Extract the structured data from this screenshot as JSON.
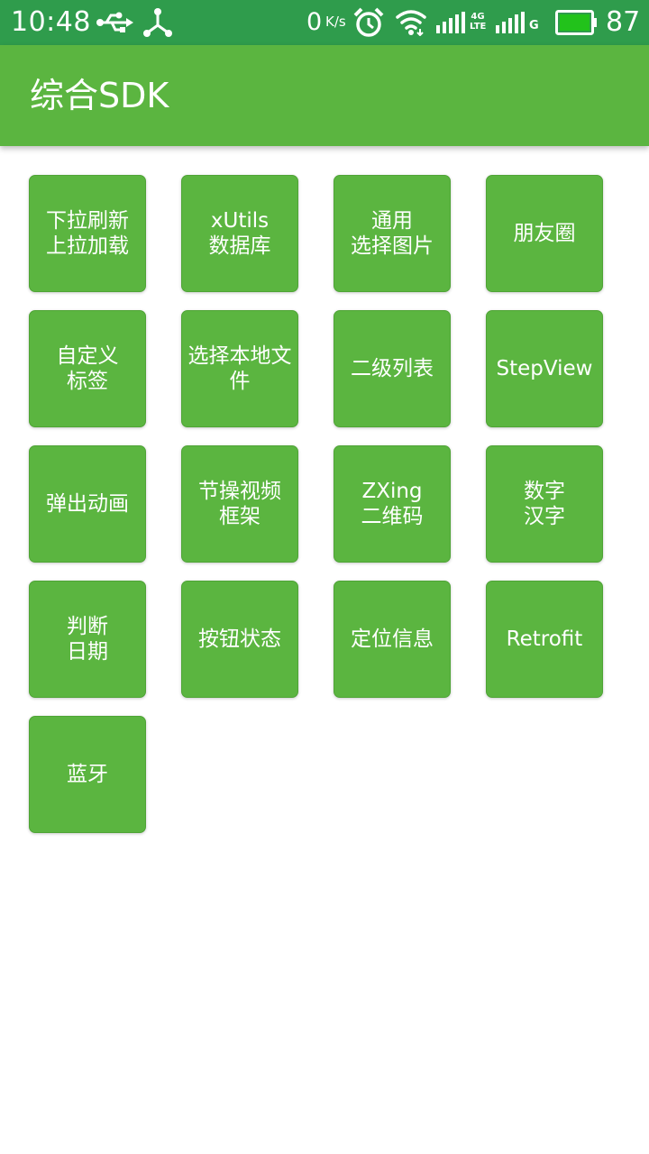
{
  "status_bar": {
    "time": "10:48",
    "net_speed": "0",
    "net_unit": "K/s",
    "signal_label_1": "4G\nLTE",
    "signal_label_2": "G",
    "battery_level": "87",
    "icons": [
      "usb-icon",
      "share-icon",
      "alarm-icon",
      "wifi-icon",
      "signal-icon",
      "signal-icon",
      "battery-icon"
    ],
    "color": "#2f9c4c"
  },
  "app_bar": {
    "title": "综合SDK",
    "color": "#5bb540"
  },
  "tiles": [
    {
      "label": "下拉刷新\n上拉加载"
    },
    {
      "label": "xUtils\n数据库"
    },
    {
      "label": "通用\n选择图片"
    },
    {
      "label": "朋友圈"
    },
    {
      "label": "自定义\n标签"
    },
    {
      "label": "选择本地文\n件"
    },
    {
      "label": "二级列表"
    },
    {
      "label": "StepView"
    },
    {
      "label": "弹出动画"
    },
    {
      "label": "节操视频\n框架"
    },
    {
      "label": "ZXing\n二维码"
    },
    {
      "label": "数字\n汉字"
    },
    {
      "label": "判断\n日期"
    },
    {
      "label": "按钮状态"
    },
    {
      "label": "定位信息"
    },
    {
      "label": "Retrofit"
    },
    {
      "label": "蓝牙"
    }
  ],
  "colors": {
    "tile": "#5bb540",
    "background": "#ffffff",
    "text": "#ffffff"
  }
}
